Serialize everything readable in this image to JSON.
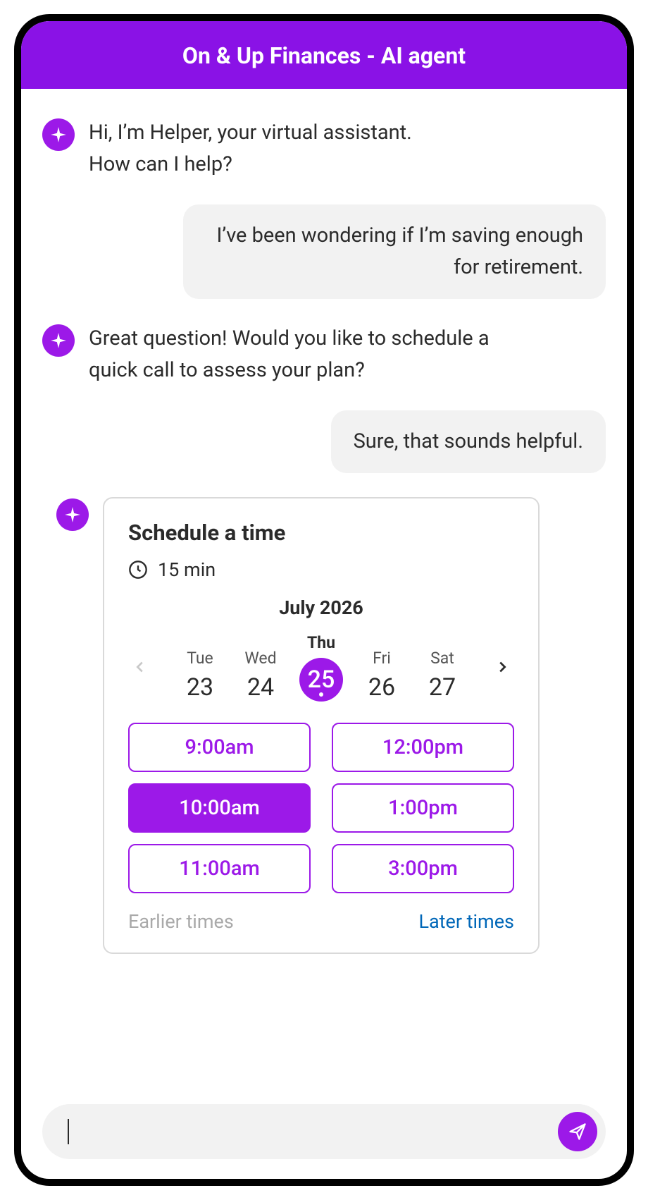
{
  "header": {
    "title": "On & Up Finances - AI agent"
  },
  "messages": {
    "bot1_line1": "Hi, I’m Helper, your virtual assistant.",
    "bot1_line2": "How can I help?",
    "user1": "I’ve been wondering if I’m saving enough for retirement.",
    "bot2": "Great question! Would you like to schedule a quick call to assess your plan?",
    "user2": "Sure, that sounds helpful."
  },
  "schedule": {
    "title": "Schedule a time",
    "duration": "15 min",
    "month": "July 2026",
    "dates": [
      {
        "dow": "Tue",
        "num": "23",
        "selected": false
      },
      {
        "dow": "Wed",
        "num": "24",
        "selected": false
      },
      {
        "dow": "Thu",
        "num": "25",
        "selected": true
      },
      {
        "dow": "Fri",
        "num": "26",
        "selected": false
      },
      {
        "dow": "Sat",
        "num": "27",
        "selected": false
      }
    ],
    "times": [
      {
        "label": "9:00am",
        "selected": false
      },
      {
        "label": "12:00pm",
        "selected": false
      },
      {
        "label": "10:00am",
        "selected": true
      },
      {
        "label": "1:00pm",
        "selected": false
      },
      {
        "label": "11:00am",
        "selected": false
      },
      {
        "label": "3:00pm",
        "selected": false
      }
    ],
    "earlier_label": "Earlier times",
    "later_label": "Later times"
  },
  "input": {
    "placeholder": ""
  },
  "colors": {
    "brand": "#9c19e8"
  }
}
